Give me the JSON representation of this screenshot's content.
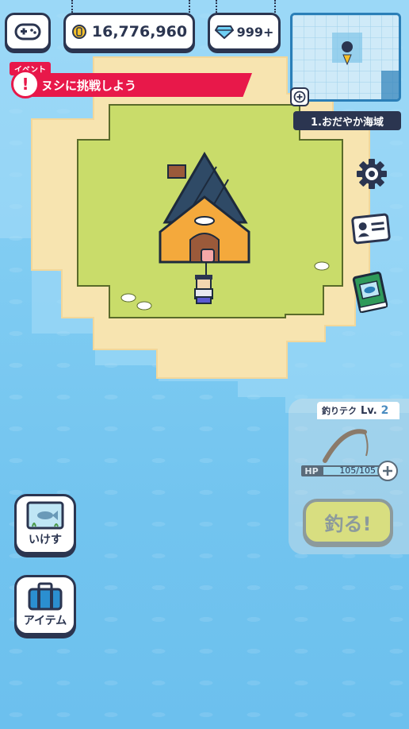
{
  "header": {
    "coins": "16,776,960",
    "gems": "999+"
  },
  "event": {
    "tag": "イベント",
    "text": "ヌシに挑戦しよう"
  },
  "map": {
    "area_label": "1.おだやか海域"
  },
  "fishing": {
    "skill_label": "釣りテク",
    "level_prefix": "Lv.",
    "level_value": "2",
    "hp_label": "HP",
    "hp_value": "105/105",
    "hp_fraction": 1.0,
    "fish_button": "釣る!"
  },
  "side_buttons": {
    "ikesu": "いけす",
    "item": "アイテム"
  },
  "colors": {
    "sea": "#7ecbf2",
    "sand": "#f7e4b0",
    "grass": "#c9dc6a",
    "outline": "#2b3550",
    "event_red": "#e8184a"
  }
}
